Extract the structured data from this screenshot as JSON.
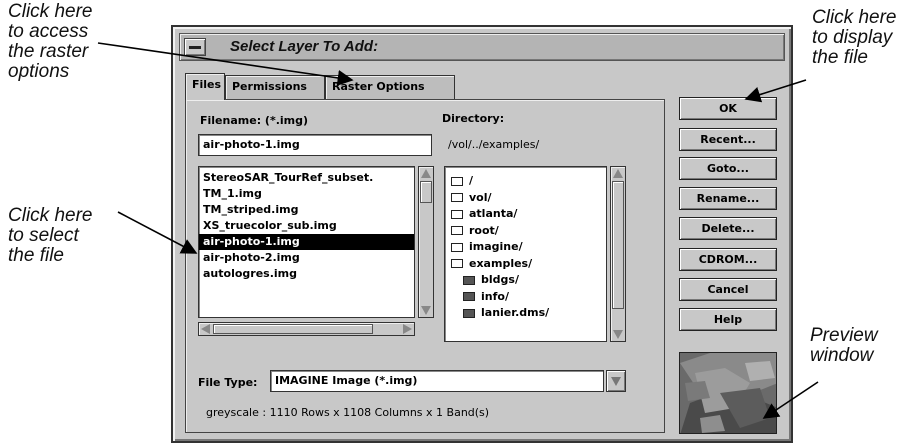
{
  "callouts": {
    "raster": "Click here\nto access\nthe raster\noptions",
    "select": "Click here\nto select\nthe file",
    "display": "Click here\nto display\nthe file",
    "preview": "Preview\nwindow"
  },
  "dialog": {
    "title": "Select Layer To Add:"
  },
  "tabs": [
    "Files",
    "Permissions",
    "Raster Options"
  ],
  "files": {
    "filename_label": "Filename: (*.img)",
    "filename_value": "air-photo-1.img",
    "file_list": [
      "StereoSAR_TourRef_subset.",
      "TM_1.img",
      "TM_striped.img",
      "XS_truecolor_sub.img",
      "air-photo-1.img",
      "air-photo-2.img",
      "autologres.img"
    ],
    "selected_index": 4,
    "directory_label": "Directory:",
    "directory_path": "/vol/../examples/",
    "dir_list": [
      {
        "name": "/",
        "icon": "open-folder-icon"
      },
      {
        "name": "vol/",
        "icon": "open-folder-icon"
      },
      {
        "name": "atlanta/",
        "icon": "open-folder-icon"
      },
      {
        "name": "root/",
        "icon": "open-folder-icon"
      },
      {
        "name": "imagine/",
        "icon": "open-folder-icon"
      },
      {
        "name": "examples/",
        "icon": "open-folder-icon"
      },
      {
        "name": "bldgs/",
        "icon": "closed-folder-icon"
      },
      {
        "name": "info/",
        "icon": "closed-folder-icon"
      },
      {
        "name": "lanier.dms/",
        "icon": "closed-folder-icon"
      }
    ],
    "filetype_label": "File Type:",
    "filetype_value": "IMAGINE Image (*.img)",
    "status": "greyscale : 1110 Rows x 1108 Columns x 1 Band(s)"
  },
  "buttons": {
    "ok": "OK",
    "recent": "Recent...",
    "goto": "Goto...",
    "rename": "Rename...",
    "delete": "Delete...",
    "cdrom": "CDROM...",
    "cancel": "Cancel",
    "help": "Help"
  }
}
